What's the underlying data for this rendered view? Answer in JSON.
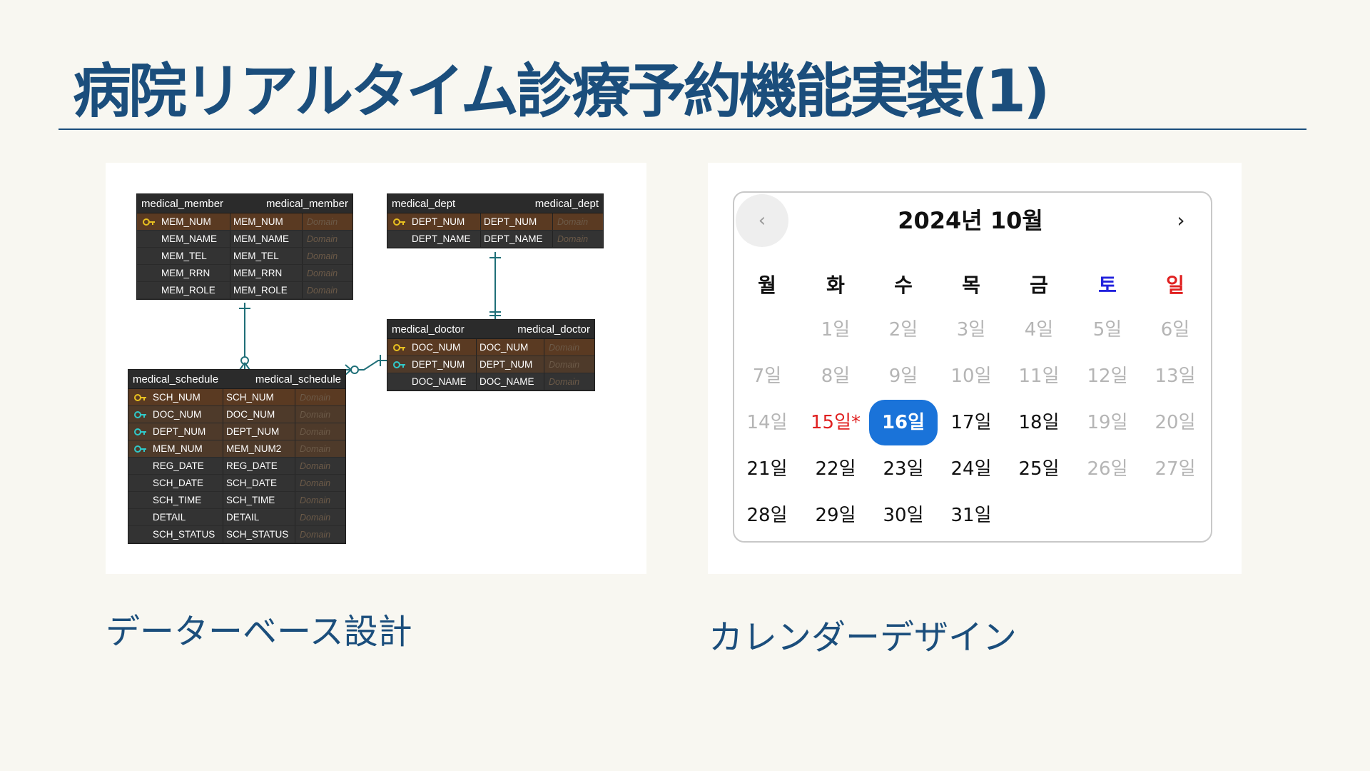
{
  "title": "病院リアルタイム診療予約機能実装(1)",
  "captions": {
    "erd": "データーベース設計",
    "calendar": "カレンダーデザイン"
  },
  "erd": {
    "domain_label": "Domain",
    "tables": [
      {
        "name": "medical_member",
        "rows": [
          {
            "c1": "MEM_NUM",
            "c2": "MEM_NUM",
            "key": "pk"
          },
          {
            "c1": "MEM_NAME",
            "c2": "MEM_NAME",
            "key": ""
          },
          {
            "c1": "MEM_TEL",
            "c2": "MEM_TEL",
            "key": ""
          },
          {
            "c1": "MEM_RRN",
            "c2": "MEM_RRN",
            "key": ""
          },
          {
            "c1": "MEM_ROLE",
            "c2": "MEM_ROLE",
            "key": ""
          }
        ]
      },
      {
        "name": "medical_dept",
        "rows": [
          {
            "c1": "DEPT_NUM",
            "c2": "DEPT_NUM",
            "key": "pk"
          },
          {
            "c1": "DEPT_NAME",
            "c2": "DEPT_NAME",
            "key": ""
          }
        ]
      },
      {
        "name": "medical_doctor",
        "rows": [
          {
            "c1": "DOC_NUM",
            "c2": "DOC_NUM",
            "key": "pk"
          },
          {
            "c1": "DEPT_NUM",
            "c2": "DEPT_NUM",
            "key": "fk"
          },
          {
            "c1": "DOC_NAME",
            "c2": "DOC_NAME",
            "key": ""
          }
        ]
      },
      {
        "name": "medical_schedule",
        "rows": [
          {
            "c1": "SCH_NUM",
            "c2": "SCH_NUM",
            "key": "pk"
          },
          {
            "c1": "DOC_NUM",
            "c2": "DOC_NUM",
            "key": "fk"
          },
          {
            "c1": "DEPT_NUM",
            "c2": "DEPT_NUM",
            "key": "fk"
          },
          {
            "c1": "MEM_NUM",
            "c2": "MEM_NUM2",
            "key": "fk"
          },
          {
            "c1": "REG_DATE",
            "c2": "REG_DATE",
            "key": ""
          },
          {
            "c1": "SCH_DATE",
            "c2": "SCH_DATE",
            "key": ""
          },
          {
            "c1": "SCH_TIME",
            "c2": "SCH_TIME",
            "key": ""
          },
          {
            "c1": "DETAIL",
            "c2": "DETAIL",
            "key": ""
          },
          {
            "c1": "SCH_STATUS",
            "c2": "SCH_STATUS",
            "key": ""
          }
        ]
      }
    ]
  },
  "calendar": {
    "header": "2024년 10월",
    "prev": "‹",
    "next": "›",
    "weekdays": [
      {
        "label": "월",
        "color": "#111111"
      },
      {
        "label": "화",
        "color": "#111111"
      },
      {
        "label": "수",
        "color": "#111111"
      },
      {
        "label": "목",
        "color": "#111111"
      },
      {
        "label": "금",
        "color": "#111111"
      },
      {
        "label": "토",
        "color": "#2222dd"
      },
      {
        "label": "일",
        "color": "#e02020"
      }
    ],
    "weeks": [
      [
        null,
        {
          "label": "1일",
          "state": "disabled"
        },
        {
          "label": "2일",
          "state": "disabled"
        },
        {
          "label": "3일",
          "state": "disabled"
        },
        {
          "label": "4일",
          "state": "disabled"
        },
        {
          "label": "5일",
          "state": "disabled"
        },
        {
          "label": "6일",
          "state": "disabled"
        }
      ],
      [
        {
          "label": "7일",
          "state": "disabled"
        },
        {
          "label": "8일",
          "state": "disabled"
        },
        {
          "label": "9일",
          "state": "disabled"
        },
        {
          "label": "10일",
          "state": "disabled"
        },
        {
          "label": "11일",
          "state": "disabled"
        },
        {
          "label": "12일",
          "state": "disabled"
        },
        {
          "label": "13일",
          "state": "disabled"
        }
      ],
      [
        {
          "label": "14일",
          "state": "disabled"
        },
        {
          "label": "15일*",
          "state": "holiday"
        },
        {
          "label": "16일",
          "state": "selected"
        },
        {
          "label": "17일",
          "state": "active"
        },
        {
          "label": "18일",
          "state": "active"
        },
        {
          "label": "19일",
          "state": "disabled"
        },
        {
          "label": "20일",
          "state": "disabled"
        }
      ],
      [
        {
          "label": "21일",
          "state": "active"
        },
        {
          "label": "22일",
          "state": "active"
        },
        {
          "label": "23일",
          "state": "active"
        },
        {
          "label": "24일",
          "state": "active"
        },
        {
          "label": "25일",
          "state": "active"
        },
        {
          "label": "26일",
          "state": "disabled"
        },
        {
          "label": "27일",
          "state": "disabled"
        }
      ],
      [
        {
          "label": "28일",
          "state": "active"
        },
        {
          "label": "29일",
          "state": "active"
        },
        {
          "label": "30일",
          "state": "active"
        },
        {
          "label": "31일",
          "state": "active"
        },
        null,
        null,
        null
      ]
    ]
  },
  "colors": {
    "title": "#1b4e7c",
    "selected": "#1a73d9",
    "pk_key": "#e8c020",
    "fk_key": "#30c8c8",
    "relation_line": "#1f6f78"
  }
}
